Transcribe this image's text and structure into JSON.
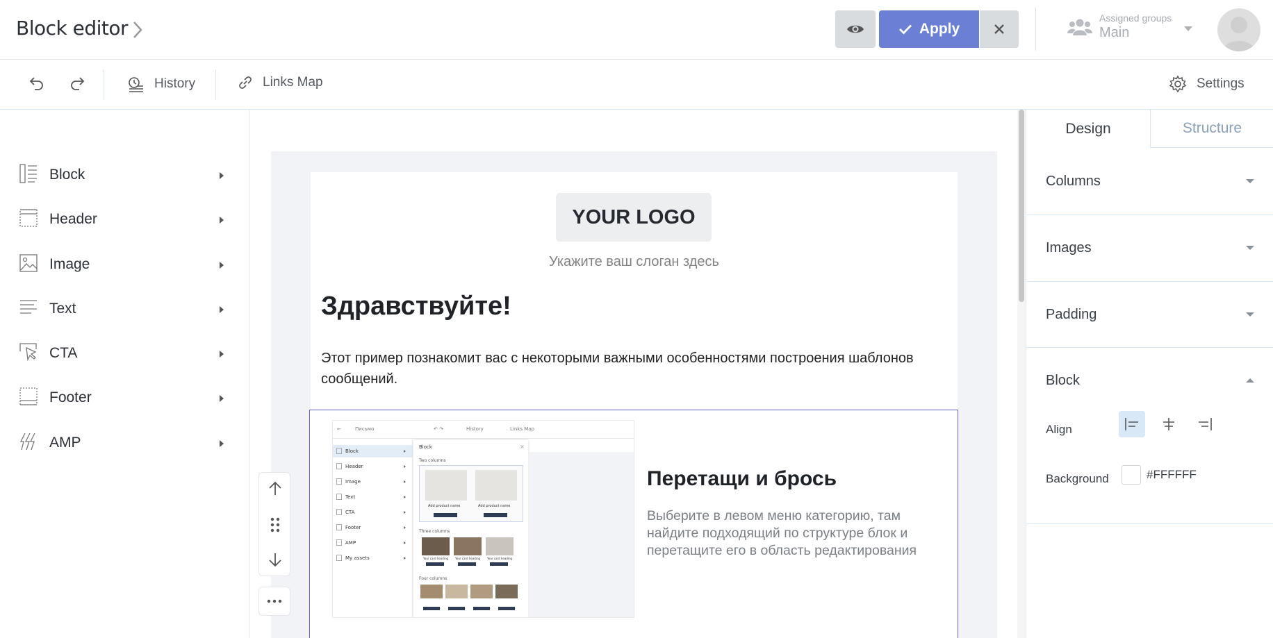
{
  "header": {
    "title": "Block editor",
    "apply_label": "Apply",
    "assigned_groups_label": "Assigned groups",
    "assigned_groups_value": "Main"
  },
  "toolbar": {
    "history_label": "History",
    "links_map_label": "Links Map",
    "settings_label": "Settings"
  },
  "left_menu": {
    "items": [
      {
        "label": "Block",
        "icon": "block-icon"
      },
      {
        "label": "Header",
        "icon": "header-icon"
      },
      {
        "label": "Image",
        "icon": "image-icon"
      },
      {
        "label": "Text",
        "icon": "text-icon"
      },
      {
        "label": "CTA",
        "icon": "cta-icon"
      },
      {
        "label": "Footer",
        "icon": "footer-icon"
      },
      {
        "label": "AMP",
        "icon": "amp-icon"
      }
    ]
  },
  "email": {
    "logo_text": "YOUR LOGO",
    "slogan": "Укажите ваш слоган здесь",
    "greeting": "Здравствуйте!",
    "intro": "Этот пример познакомит вас с некоторыми важными особенностями построения шаблонов сообщений.",
    "dnd_title": "Перетащи и брось",
    "dnd_text": "Выберите в левом меню категорию, там найдите подходящий по структуре блок и перетащите его в область редактирования"
  },
  "mini_screenshot": {
    "title": "Письмо",
    "history": "History",
    "links_map": "Links Map",
    "panel_title": "Block",
    "two_columns": "Two columns",
    "three_columns": "Three columns",
    "four_columns": "Four columns",
    "product_name": "Add product name",
    "card_heading": "Your card heading",
    "menu": [
      "Block",
      "Header",
      "Image",
      "Text",
      "CTA",
      "Footer",
      "AMP",
      "My assets"
    ]
  },
  "right_panel": {
    "tabs": [
      "Design",
      "Structure"
    ],
    "sections": [
      "Columns",
      "Images",
      "Padding",
      "Block"
    ],
    "align_label": "Align",
    "background_label": "Background",
    "background_value": "#FFFFFF"
  },
  "colors": {
    "accent": "#6b7fd4",
    "selection_border": "#6066c9",
    "canvas_bg": "#f1f3f7",
    "align_active_bg": "#d8e8f7"
  }
}
